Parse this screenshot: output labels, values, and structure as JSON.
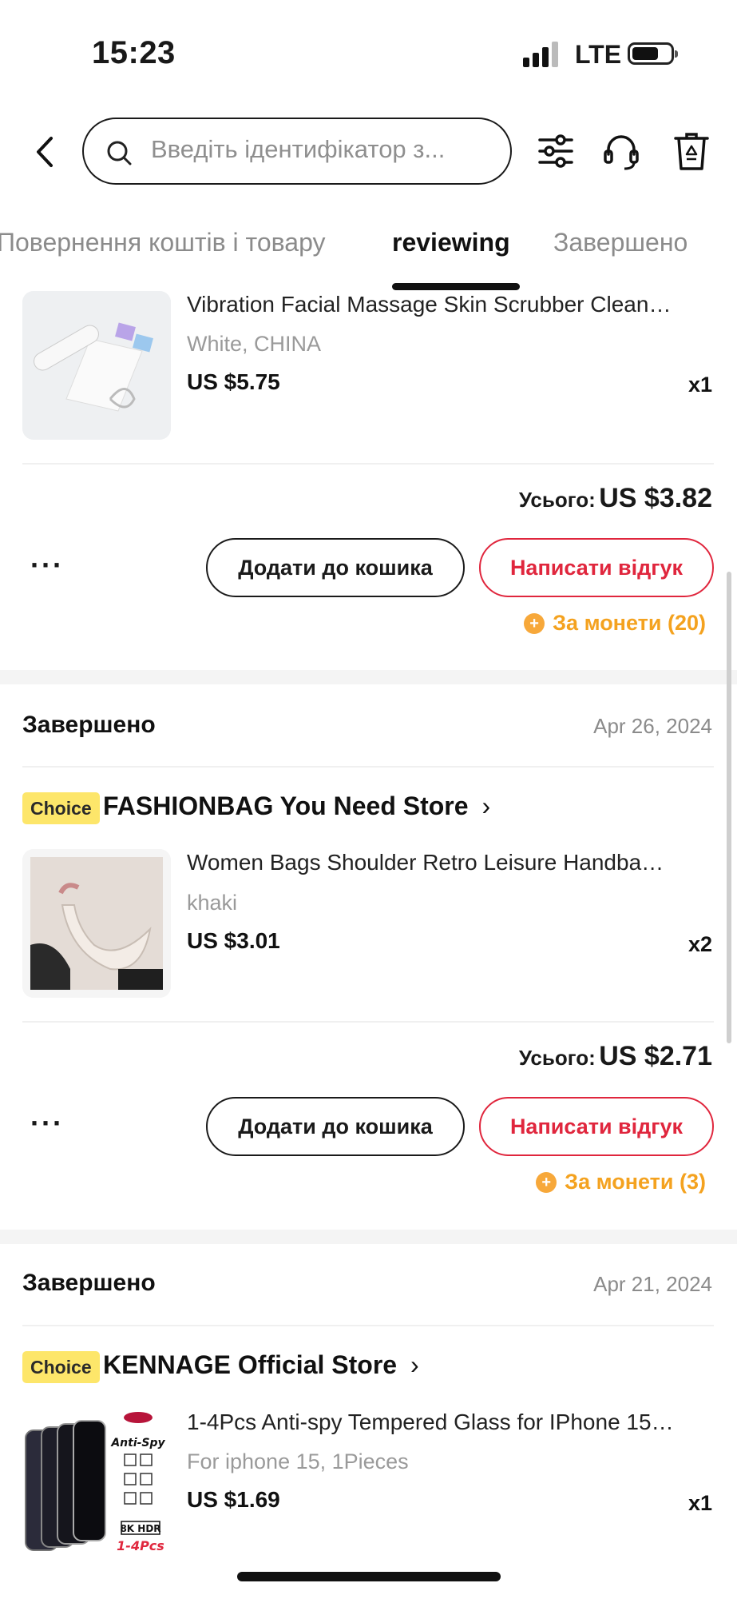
{
  "status_bar": {
    "time": "15:23",
    "network": "LTE"
  },
  "header": {
    "search_placeholder": "Введіть ідентифікатор з..."
  },
  "tabs": [
    {
      "label": "Повернення коштів і товару",
      "active": false
    },
    {
      "label": "reviewing",
      "active": true
    },
    {
      "label": "Завершено",
      "active": false
    }
  ],
  "orders": [
    {
      "status": "",
      "date": "",
      "store": "",
      "product": {
        "title": "Vibration Facial Massage Skin Scrubber Cleaner Io...",
        "variant": "White, CHINA",
        "price": "US $5.75",
        "qty": "x1"
      },
      "total_label": "Усього:",
      "total_value": "US $3.82",
      "more": "···",
      "add_to_cart": "Додати до кошика",
      "write_review": "Написати відгук",
      "coins": "За монети (20)"
    },
    {
      "status": "Завершено",
      "date": "Apr 26, 2024",
      "badge": "Choice",
      "store": "FASHIONBAG You Need Store",
      "product": {
        "title": "Women Bags Shoulder Retro Leisure Handbag Pur...",
        "variant": "khaki",
        "price": "US $3.01",
        "qty": "x2"
      },
      "total_label": "Усього:",
      "total_value": "US $2.71",
      "more": "···",
      "add_to_cart": "Додати до кошика",
      "write_review": "Написати відгук",
      "coins": "За монети (3)"
    },
    {
      "status": "Завершено",
      "date": "Apr 21, 2024",
      "badge": "Choice",
      "store": "KENNAGE Official Store",
      "product": {
        "title": "1-4Pcs Anti-spy Tempered Glass for IPhone 15 14 1...",
        "variant": "For iphone 15, 1Pieces",
        "price": "US $1.69",
        "qty": "x1",
        "thumb_text_top": "Anti-Spy",
        "thumb_text_mid": "8K HDR",
        "thumb_text_bottom": "1-4Pcs"
      }
    }
  ],
  "colors": {
    "accent_red": "#e0263d",
    "coin_orange": "#f4a21f",
    "choice_yellow": "#fde66a"
  }
}
